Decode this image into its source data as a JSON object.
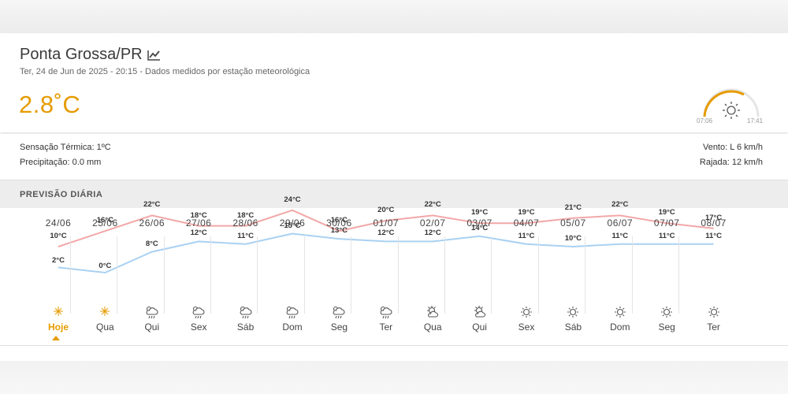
{
  "header": {
    "city": "Ponta Grossa/PR",
    "subtitle": "Ter, 24 de Jun de 2025 - 20:15 - Dados medidos por estação meteorológica",
    "temperature": "2.8˚C",
    "sunrise": "07:06",
    "sunset": "17:41"
  },
  "details": {
    "feels_like": "Sensação Térmica: 1ºC",
    "precipitation": "Precipitação: 0.0 mm",
    "wind": "Vento: L 6 km/h",
    "gust": "Rajada: 12 km/h"
  },
  "forecast": {
    "section_title": "PREVISÃO DIÁRIA",
    "days": [
      {
        "date": "24/06",
        "max": "10°C",
        "min": "2°C",
        "name": "Hoje",
        "icon": "moon-star-icon"
      },
      {
        "date": "25/06",
        "max": "16°C",
        "min": "0°C",
        "name": "Qua",
        "icon": "moon-star-icon"
      },
      {
        "date": "26/06",
        "max": "22°C",
        "min": "8°C",
        "name": "Qui",
        "icon": "cloud-rain-sun-icon"
      },
      {
        "date": "27/06",
        "max": "18°C",
        "min": "12°C",
        "name": "Sex",
        "icon": "cloud-rain-sun-icon"
      },
      {
        "date": "28/06",
        "max": "18°C",
        "min": "11°C",
        "name": "Sáb",
        "icon": "cloud-rain-sun-icon"
      },
      {
        "date": "29/06",
        "max": "24°C",
        "min": "15°C",
        "name": "Dom",
        "icon": "cloud-rain-sun-icon"
      },
      {
        "date": "30/06",
        "max": "16°C",
        "min": "13°C",
        "name": "Seg",
        "icon": "cloud-rain-sun-icon"
      },
      {
        "date": "01/07",
        "max": "20°C",
        "min": "12°C",
        "name": "Ter",
        "icon": "cloud-rain-sun-icon"
      },
      {
        "date": "02/07",
        "max": "22°C",
        "min": "12°C",
        "name": "Qua",
        "icon": "partly-cloudy-icon"
      },
      {
        "date": "03/07",
        "max": "19°C",
        "min": "14°C",
        "name": "Qui",
        "icon": "partly-cloudy-icon"
      },
      {
        "date": "04/07",
        "max": "19°C",
        "min": "11°C",
        "name": "Sex",
        "icon": "sun-icon"
      },
      {
        "date": "05/07",
        "max": "21°C",
        "min": "10°C",
        "name": "Sáb",
        "icon": "sun-icon"
      },
      {
        "date": "06/07",
        "max": "22°C",
        "min": "11°C",
        "name": "Dom",
        "icon": "sun-icon"
      },
      {
        "date": "07/07",
        "max": "19°C",
        "min": "11°C",
        "name": "Seg",
        "icon": "sun-icon"
      },
      {
        "date": "08/07",
        "max": "17°C",
        "min": "11°C",
        "name": "Ter",
        "icon": "sun-icon"
      }
    ]
  },
  "chart_data": {
    "type": "line",
    "x": [
      "24/06",
      "25/06",
      "26/06",
      "27/06",
      "28/06",
      "29/06",
      "30/06",
      "01/07",
      "02/07",
      "03/07",
      "04/07",
      "05/07",
      "06/07",
      "07/07",
      "08/07"
    ],
    "series": [
      {
        "values": [
          10,
          16,
          22,
          18,
          18,
          24,
          16,
          20,
          22,
          19,
          19,
          21,
          22,
          19,
          17
        ],
        "color": "#f2a7a7"
      },
      {
        "values": [
          2,
          0,
          8,
          12,
          11,
          15,
          13,
          12,
          12,
          14,
          11,
          10,
          11,
          11,
          11
        ],
        "color": "#a9d1f2"
      }
    ]
  },
  "colors": {
    "accent": "#e69b00",
    "max_line": "#f2a7a7",
    "min_line": "#a9d1f2"
  }
}
